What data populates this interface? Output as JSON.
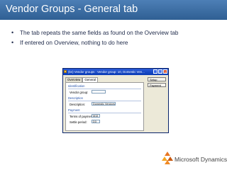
{
  "slide": {
    "title": "Vendor Groups - General tab",
    "bullets": [
      "The tab repeats the same fields as found on the Overview tab",
      "If entered on Overview, nothing to do here"
    ],
    "accent_color": "#3a6ea5"
  },
  "dialog": {
    "title": "(kn) Vendor groups : Vendor group: 10, Domestic Ven...",
    "tabs": [
      "Overview",
      "General"
    ],
    "active_tab": "General",
    "groups": {
      "identification": "Identification",
      "description": "Description",
      "payment": "Payment"
    },
    "fields": {
      "vendor_group_label": "Vendor group:",
      "vendor_group_value": "",
      "description_label": "Description:",
      "description_value": "Domestic Vendors",
      "terms_label": "Terms of payment:",
      "terms_value": "M15",
      "settle_label": "Settle period:",
      "settle_value": "D3"
    },
    "buttons": {
      "setup": "Setup",
      "payment": "Payment"
    }
  },
  "branding": {
    "company": "Microsoft Dynamics"
  }
}
